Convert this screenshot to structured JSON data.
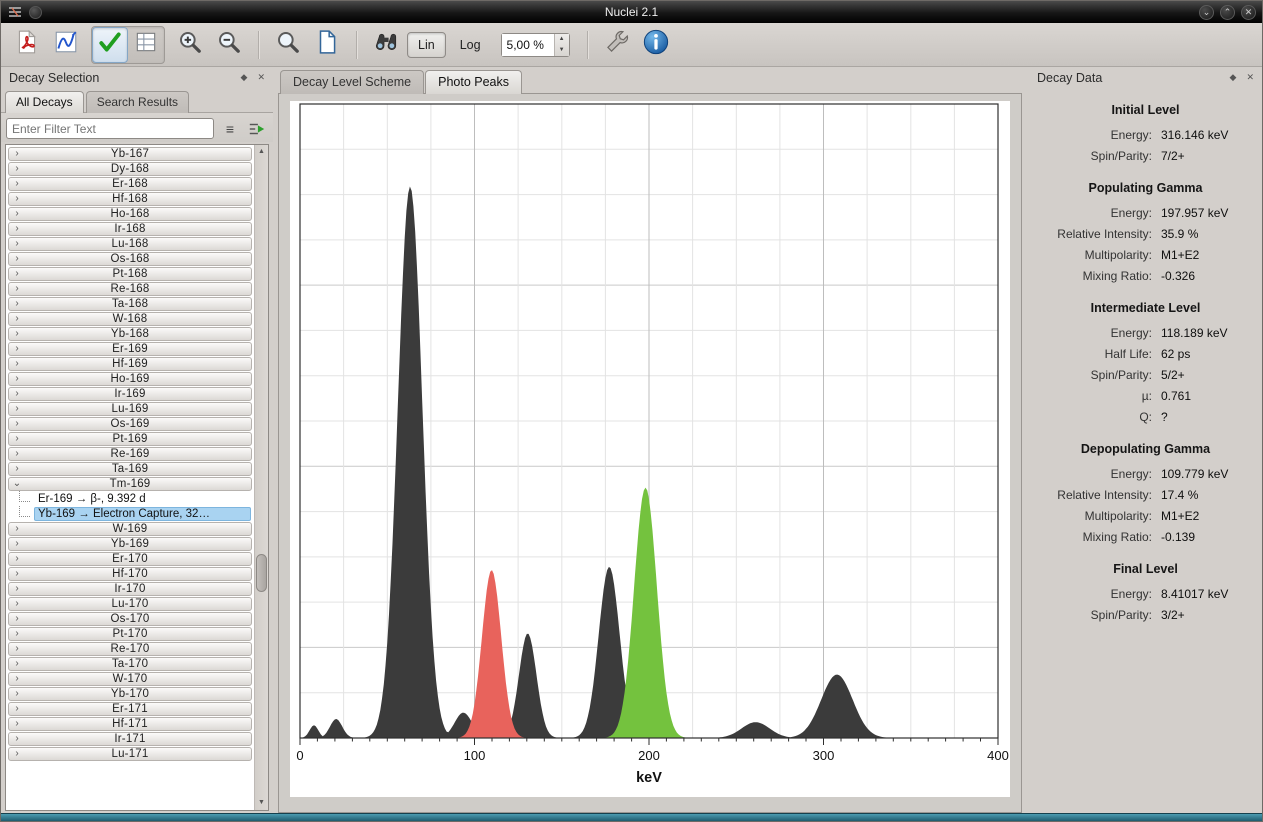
{
  "window": {
    "title": "Nuclei 2.1"
  },
  "icons": {
    "minimize": "⌄",
    "maximize": "⌃",
    "close": "✕",
    "dock_float": "◆",
    "dock_close": "✕",
    "scroll_up": "▲",
    "scroll_down": "▼",
    "spin_up": "▲",
    "spin_down": "▼",
    "chevron_right": "›",
    "chevron_down": "⌄",
    "filter_list": "≡"
  },
  "toolbar": {
    "lin_label": "Lin",
    "log_label": "Log",
    "zoom_value": "5,00 %"
  },
  "decay_selection": {
    "title": "Decay Selection",
    "tabs": [
      {
        "label": "All Decays"
      },
      {
        "label": "Search Results"
      }
    ],
    "filter_placeholder": "Enter Filter Text",
    "items": [
      "Yb-167",
      "Dy-168",
      "Er-168",
      "Hf-168",
      "Ho-168",
      "Ir-168",
      "Lu-168",
      "Os-168",
      "Pt-168",
      "Re-168",
      "Ta-168",
      "W-168",
      "Yb-168",
      "Er-169",
      "Hf-169",
      "Ho-169",
      "Ir-169",
      "Lu-169",
      "Os-169",
      "Pt-169",
      "Re-169",
      "Ta-169",
      {
        "label": "Tm-169",
        "expanded": true,
        "children": [
          {
            "label": "Er-169 → β-, 9.392 d"
          },
          {
            "label": "Yb-169 → Electron Capture, 32…",
            "selected": true
          }
        ]
      },
      "W-169",
      "Yb-169",
      "Er-170",
      "Hf-170",
      "Ir-170",
      "Lu-170",
      "Os-170",
      "Pt-170",
      "Re-170",
      "Ta-170",
      "W-170",
      "Yb-170",
      "Er-171",
      "Hf-171",
      "Ir-171",
      "Lu-171"
    ]
  },
  "center": {
    "tabs": [
      {
        "label": "Decay Level Scheme"
      },
      {
        "label": "Photo Peaks"
      }
    ]
  },
  "chart_data": {
    "type": "area",
    "xlabel": "keV",
    "xlim": [
      0,
      400
    ],
    "ylim": [
      0,
      1
    ],
    "x_major_ticks": [
      0,
      100,
      200,
      300,
      400
    ],
    "x_minor_tick_step": 10,
    "grid_minor_step_x": 25,
    "grid_major_step_x": 100,
    "colors": {
      "dark": "#3b3b3b",
      "red": "#e8635c",
      "green": "#74c23e"
    },
    "spectrum_peaks": [
      {
        "center": 8,
        "height": 0.02,
        "sigma": 2.5,
        "layer": "dark"
      },
      {
        "center": 20.7,
        "height": 0.03,
        "sigma": 3.5,
        "layer": "dark"
      },
      {
        "center": 63.1,
        "height": 0.87,
        "sigma": 7.0,
        "layer": "dark"
      },
      {
        "center": 93.6,
        "height": 0.04,
        "sigma": 5.0,
        "layer": "dark"
      },
      {
        "center": 109.8,
        "height": 0.21,
        "sigma": 5.5,
        "layer": "dark"
      },
      {
        "center": 130.5,
        "height": 0.165,
        "sigma": 5.0,
        "layer": "dark"
      },
      {
        "center": 177.2,
        "height": 0.27,
        "sigma": 6.0,
        "layer": "dark"
      },
      {
        "center": 198.0,
        "height": 0.31,
        "sigma": 6.5,
        "layer": "dark"
      },
      {
        "center": 261.1,
        "height": 0.025,
        "sigma": 8.0,
        "layer": "dark"
      },
      {
        "center": 307.7,
        "height": 0.1,
        "sigma": 9.0,
        "layer": "dark"
      },
      {
        "center": 109.8,
        "height": 0.265,
        "sigma": 5.5,
        "layer": "red"
      },
      {
        "center": 198.0,
        "height": 0.395,
        "sigma": 6.5,
        "layer": "green"
      }
    ]
  },
  "decay_data": {
    "title": "Decay Data",
    "sections": [
      {
        "heading": "Initial Level",
        "rows": [
          [
            "Energy:",
            "316.146 keV"
          ],
          [
            "Spin/Parity:",
            "7/2+"
          ]
        ]
      },
      {
        "heading": "Populating Gamma",
        "rows": [
          [
            "Energy:",
            "197.957 keV"
          ],
          [
            "Relative Intensity:",
            "35.9 %"
          ],
          [
            "Multipolarity:",
            "M1+E2"
          ],
          [
            "Mixing Ratio:",
            "-0.326"
          ]
        ]
      },
      {
        "heading": "Intermediate Level",
        "rows": [
          [
            "Energy:",
            "118.189 keV"
          ],
          [
            "Half Life:",
            "62 ps"
          ],
          [
            "Spin/Parity:",
            "5/2+"
          ],
          [
            "µ:",
            "0.761"
          ],
          [
            "Q:",
            "?"
          ]
        ]
      },
      {
        "heading": "Depopulating Gamma",
        "rows": [
          [
            "Energy:",
            "109.779 keV"
          ],
          [
            "Relative Intensity:",
            "17.4 %"
          ],
          [
            "Multipolarity:",
            "M1+E2"
          ],
          [
            "Mixing Ratio:",
            "-0.139"
          ]
        ]
      },
      {
        "heading": "Final Level",
        "rows": [
          [
            "Energy:",
            "8.41017 keV"
          ],
          [
            "Spin/Parity:",
            "3/2+"
          ]
        ]
      }
    ]
  }
}
